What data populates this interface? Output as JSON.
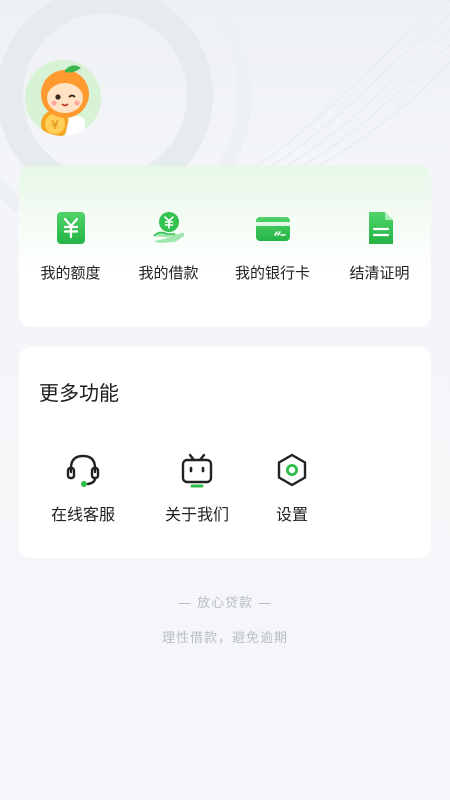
{
  "profile": {
    "avatar_desc": "orange mascot avatar"
  },
  "quick_actions": [
    {
      "label": "我的额度",
      "icon": "yuan-card-icon"
    },
    {
      "label": "我的借款",
      "icon": "hand-yuan-icon"
    },
    {
      "label": "我的银行卡",
      "icon": "bank-card-icon"
    },
    {
      "label": "结清证明",
      "icon": "document-icon"
    }
  ],
  "more": {
    "title": "更多功能",
    "items": [
      {
        "label": "在线客服",
        "icon": "headset-icon"
      },
      {
        "label": "关于我们",
        "icon": "tv-robot-icon"
      },
      {
        "label": "设置",
        "icon": "hexagon-settings-icon"
      }
    ]
  },
  "footer": {
    "brand": "— 放心贷款 —",
    "slogan": "理性借款，避免逾期"
  },
  "colors": {
    "accent": "#2dbe4c",
    "accent_light": "#8fe0a0",
    "text": "#222222",
    "muted": "#b9bdc4"
  }
}
